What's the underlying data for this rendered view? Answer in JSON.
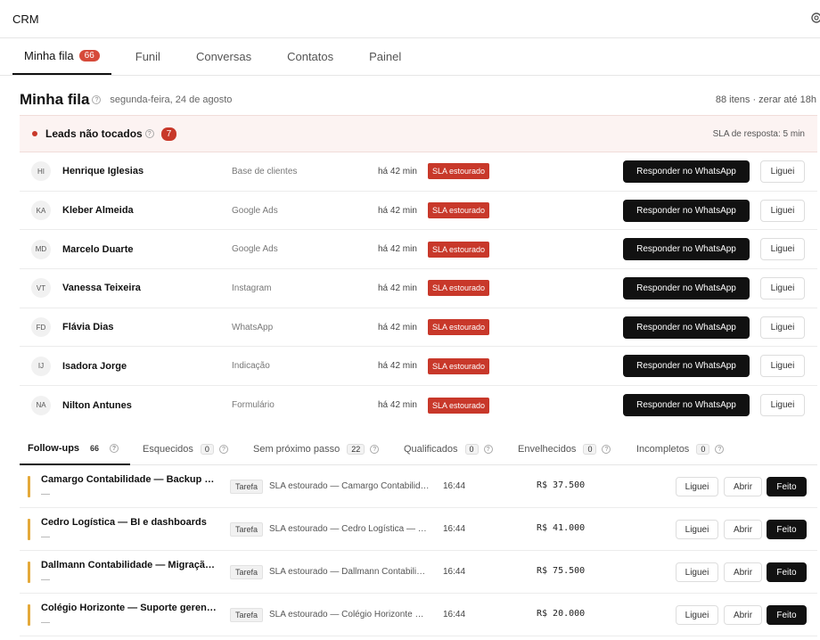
{
  "app": {
    "title": "CRM"
  },
  "tabs": [
    {
      "label": "Minha fila",
      "badge": "66"
    },
    {
      "label": "Funil"
    },
    {
      "label": "Conversas"
    },
    {
      "label": "Contatos"
    },
    {
      "label": "Painel"
    }
  ],
  "header": {
    "title": "Minha fila",
    "help": "?",
    "date": "segunda-feira, 24 de agosto",
    "summary": "88 itens · zerar até 18h"
  },
  "leads_section": {
    "title": "Leads não tocados",
    "help": "?",
    "count": "7",
    "sla_text": "SLA de resposta: 5 min"
  },
  "leads": [
    {
      "initials": "HI",
      "name": "Henrique Iglesias",
      "source": "Base de clientes",
      "time": "há 42 min",
      "status": "SLA estourado",
      "primary": "Responder no WhatsApp",
      "secondary": "Liguei"
    },
    {
      "initials": "KA",
      "name": "Kleber Almeida",
      "source": "Google Ads",
      "time": "há 42 min",
      "status": "SLA estourado",
      "primary": "Responder no WhatsApp",
      "secondary": "Liguei"
    },
    {
      "initials": "MD",
      "name": "Marcelo Duarte",
      "source": "Google Ads",
      "time": "há 42 min",
      "status": "SLA estourado",
      "primary": "Responder no WhatsApp",
      "secondary": "Liguei"
    },
    {
      "initials": "VT",
      "name": "Vanessa Teixeira",
      "source": "Instagram",
      "time": "há 42 min",
      "status": "SLA estourado",
      "primary": "Responder no WhatsApp",
      "secondary": "Liguei"
    },
    {
      "initials": "FD",
      "name": "Flávia Dias",
      "source": "WhatsApp",
      "time": "há 42 min",
      "status": "SLA estourado",
      "primary": "Responder no WhatsApp",
      "secondary": "Liguei"
    },
    {
      "initials": "IJ",
      "name": "Isadora Jorge",
      "source": "Indicação",
      "time": "há 42 min",
      "status": "SLA estourado",
      "primary": "Responder no WhatsApp",
      "secondary": "Liguei"
    },
    {
      "initials": "NA",
      "name": "Nilton Antunes",
      "source": "Formulário",
      "time": "há 42 min",
      "status": "SLA estourado",
      "primary": "Responder no WhatsApp",
      "secondary": "Liguei"
    }
  ],
  "subtabs": [
    {
      "label": "Follow-ups",
      "count": "66"
    },
    {
      "label": "Esquecidos",
      "count": "0"
    },
    {
      "label": "Sem próximo passo",
      "count": "22"
    },
    {
      "label": "Qualificados",
      "count": "0"
    },
    {
      "label": "Envelhecidos",
      "count": "0"
    },
    {
      "label": "Incompletos",
      "count": "0"
    }
  ],
  "followups": [
    {
      "title": "Camargo Contabilidade — Backup e …",
      "sub": "—",
      "tag": "Tarefa",
      "desc": "SLA estourado — Camargo Contabilid…",
      "time": "16:44",
      "value": "R$ 37.500",
      "b1": "Liguei",
      "b2": "Abrir",
      "b3": "Feito"
    },
    {
      "title": "Cedro Logística — BI e dashboards",
      "sub": "—",
      "tag": "Tarefa",
      "desc": "SLA estourado — Cedro Logística — BI…",
      "time": "16:44",
      "value": "R$ 41.000",
      "b1": "Liguei",
      "b2": "Abrir",
      "b3": "Feito"
    },
    {
      "title": "Dallmann Contabilidade — Migração …",
      "sub": "—",
      "tag": "Tarefa",
      "desc": "SLA estourado — Dallmann Contabili…",
      "time": "16:44",
      "value": "R$ 75.500",
      "b1": "Liguei",
      "b2": "Abrir",
      "b3": "Feito"
    },
    {
      "title": "Colégio Horizonte — Suporte gerenci…",
      "sub": "—",
      "tag": "Tarefa",
      "desc": "SLA estourado — Colégio Horizonte —…",
      "time": "16:44",
      "value": "R$ 20.000",
      "b1": "Liguei",
      "b2": "Abrir",
      "b3": "Feito"
    }
  ]
}
